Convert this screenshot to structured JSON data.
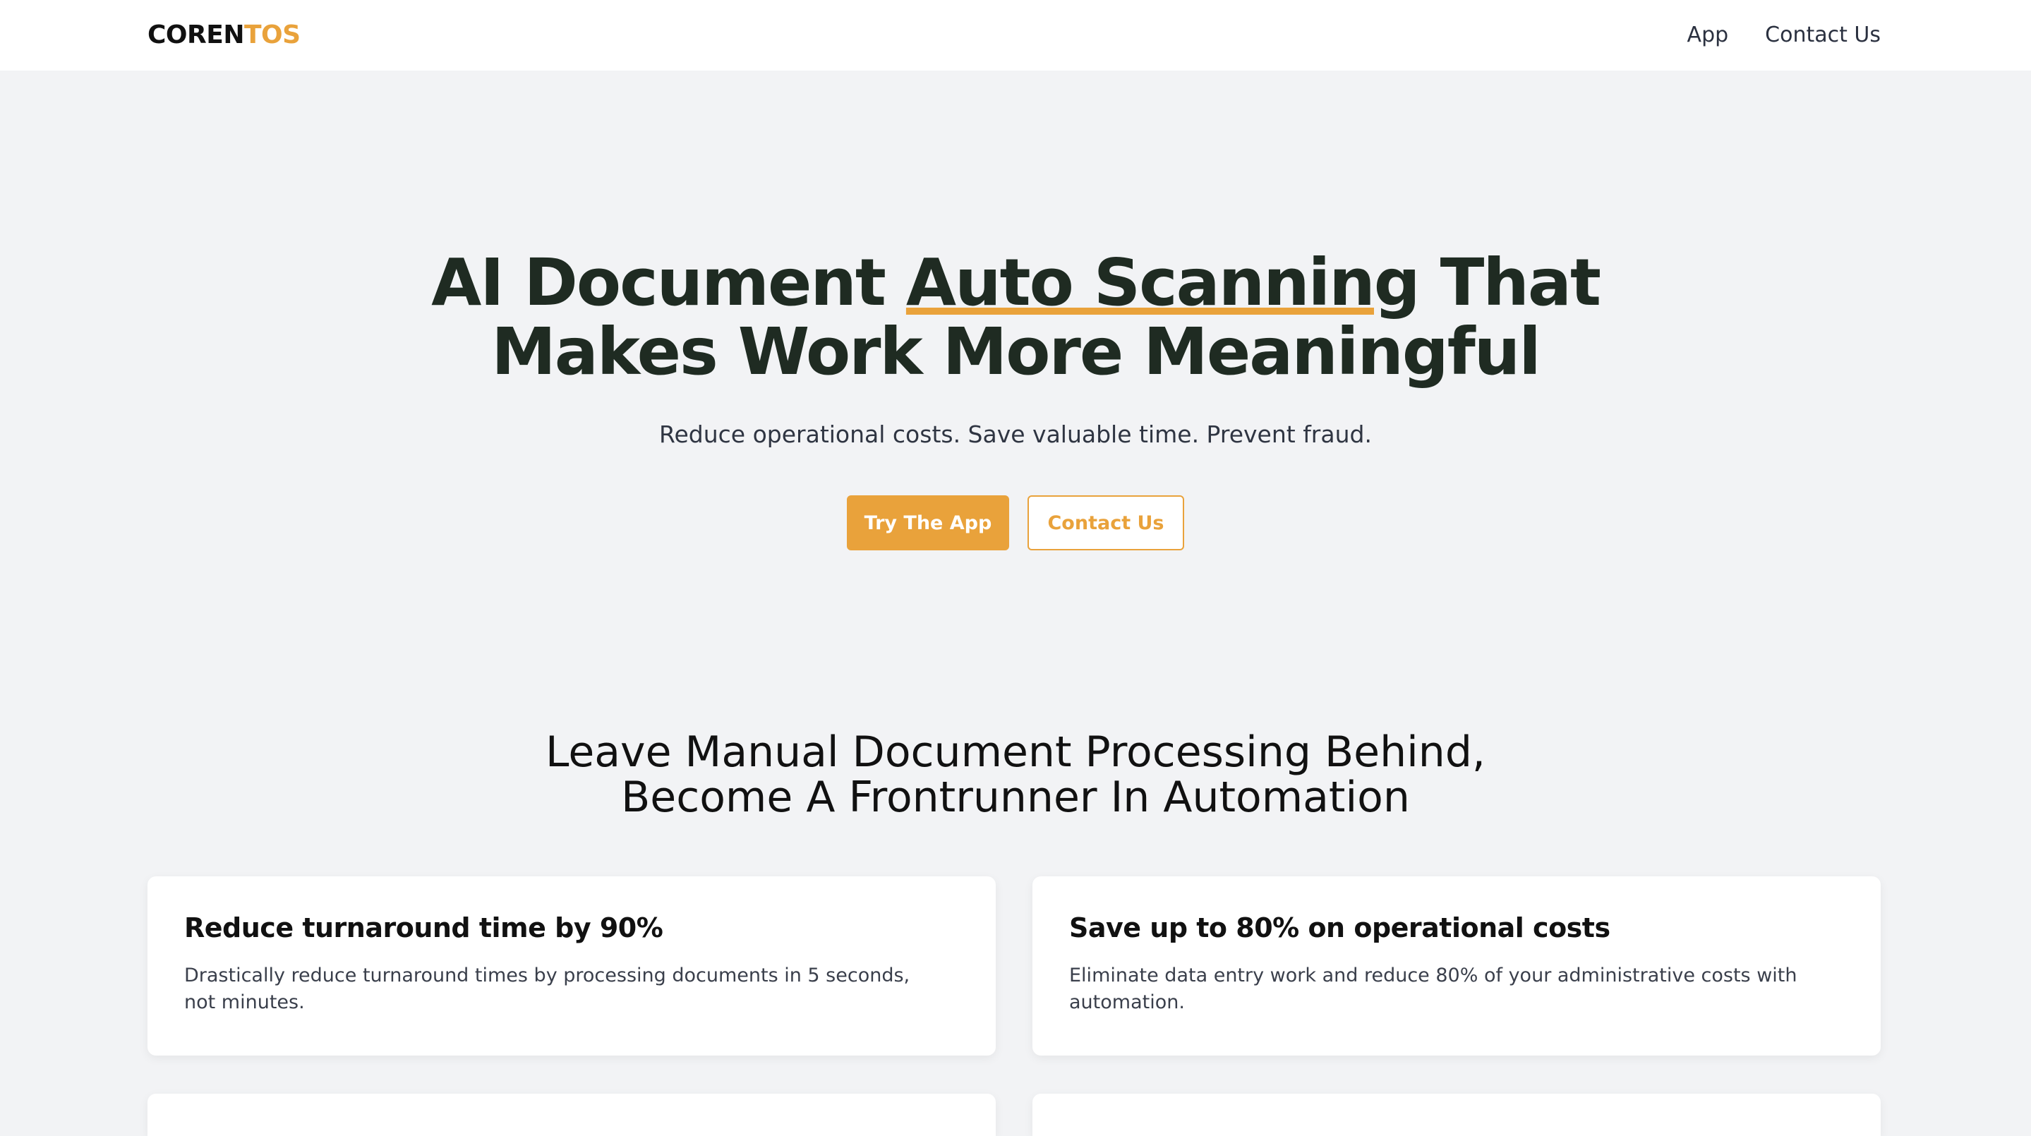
{
  "nav": {
    "logo_dark": "COREN",
    "logo_accent": "TOS",
    "links": [
      "App",
      "Contact Us"
    ]
  },
  "hero": {
    "title_before": "AI Document ",
    "title_highlight": "Auto Scanning",
    "title_line1_after": " That",
    "title_line2": "Makes Work More Meaningful",
    "subtitle": "Reduce operational costs. Save valuable time. Prevent fraud.",
    "primary_button": "Try The App",
    "secondary_button": "Contact Us"
  },
  "section": {
    "title_line1": "Leave Manual Document Processing Behind,",
    "title_line2": "Become A Frontrunner In Automation"
  },
  "cards": [
    {
      "title": "Reduce turnaround time by 90%",
      "description": "Drastically reduce turnaround times by processing documents in 5 seconds, not minutes."
    },
    {
      "title": "Save up to 80% on operational costs",
      "description": "Eliminate data entry work and reduce 80% of your administrative costs with automation."
    }
  ],
  "colors": {
    "accent": "#e9a23b",
    "heading": "#1f2b22",
    "background": "#f2f3f5"
  }
}
